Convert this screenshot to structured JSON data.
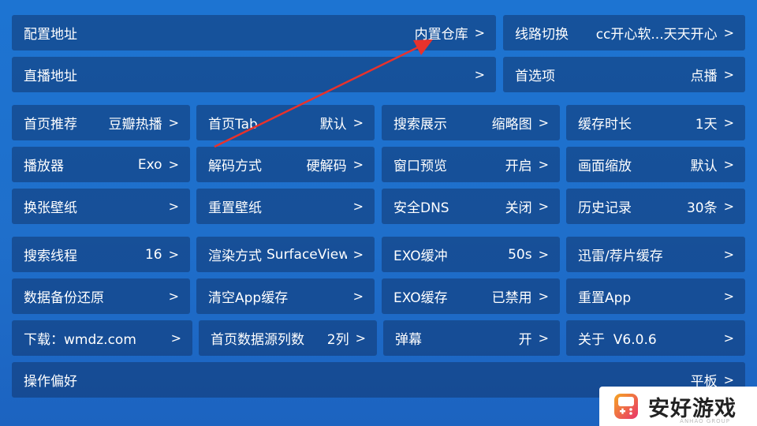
{
  "top_rows": [
    {
      "label": "配置地址",
      "value": "内置仓库",
      "chevron": ">"
    },
    {
      "label": "线路切换",
      "value": "cc开心软...天天开心",
      "chevron": ">"
    },
    {
      "label": "直播地址",
      "value": "",
      "chevron": ">"
    },
    {
      "label": "首选项",
      "value": "点播",
      "chevron": ">"
    }
  ],
  "grid": [
    [
      {
        "label": "首页推荐",
        "value": "豆瓣热播",
        "chevron": ">"
      },
      {
        "label": "首页Tab",
        "value": "默认",
        "chevron": ">"
      },
      {
        "label": "搜索展示",
        "value": "缩略图",
        "chevron": ">"
      },
      {
        "label": "缓存时长",
        "value": "1天",
        "chevron": ">"
      }
    ],
    [
      {
        "label": "播放器",
        "value": "Exo",
        "chevron": ">"
      },
      {
        "label": "解码方式",
        "value": "硬解码",
        "chevron": ">"
      },
      {
        "label": "窗口预览",
        "value": "开启",
        "chevron": ">"
      },
      {
        "label": "画面缩放",
        "value": "默认",
        "chevron": ">"
      }
    ],
    [
      {
        "label": "换张壁纸",
        "value": "",
        "chevron": ">"
      },
      {
        "label": "重置壁纸",
        "value": "",
        "chevron": ">"
      },
      {
        "label": "安全DNS",
        "value": "关闭",
        "chevron": ">"
      },
      {
        "label": "历史记录",
        "value": "30条",
        "chevron": ">"
      }
    ],
    [
      {
        "label": "搜索线程",
        "value": "16",
        "chevron": ">"
      },
      {
        "label": "渲染方式",
        "value": "SurfaceView",
        "chevron": ">"
      },
      {
        "label": "EXO缓冲",
        "value": "50s",
        "chevron": ">"
      },
      {
        "label": "迅雷/荐片缓存",
        "value": "",
        "chevron": ">"
      }
    ],
    [
      {
        "label": "数据备份还原",
        "value": "",
        "chevron": ">"
      },
      {
        "label": "清空App缓存",
        "value": "",
        "chevron": ">"
      },
      {
        "label": "EXO缓存",
        "value": "已禁用",
        "chevron": ">"
      },
      {
        "label": "重置App",
        "value": "",
        "chevron": ">"
      }
    ],
    [
      {
        "label": "下载：wmdz.com",
        "value": "",
        "chevron": ">"
      },
      {
        "label": "首页数据源列数",
        "value": "2列",
        "chevron": ">"
      },
      {
        "label": "弹幕",
        "value": "开",
        "chevron": ">"
      },
      {
        "label": "关于  V6.0.6",
        "value": "",
        "chevron": ">"
      }
    ]
  ],
  "bottom_row": {
    "label": "操作偏好",
    "value": "平板",
    "chevron": ">"
  },
  "annotation": {
    "color": "#e8322c"
  },
  "watermark": {
    "text": "安好游戏",
    "subtext": "ANHAO GROUP",
    "icon": "gamepad-icon",
    "colors": {
      "gradient_start": "#f5a623",
      "gradient_end": "#e8336b",
      "text": "#222222"
    }
  },
  "colors": {
    "background": "#1d6fcb",
    "tile": "#1a3f78",
    "text": "#ffffff"
  }
}
